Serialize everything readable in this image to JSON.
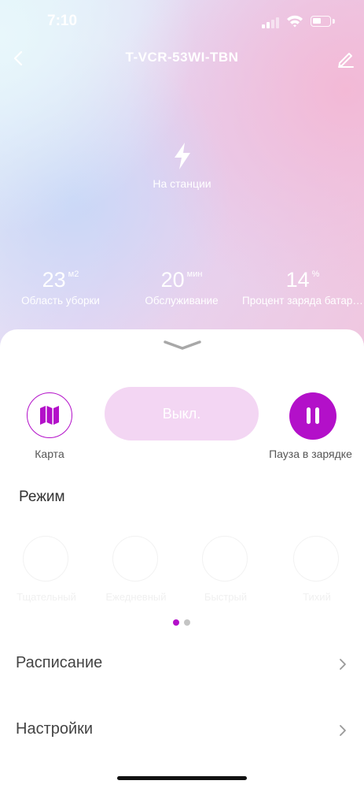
{
  "status_bar": {
    "time": "7:10",
    "battery_level": 0.55
  },
  "header": {
    "title": "T-VCR-53WI-TBN"
  },
  "device_status": {
    "text": "На станции"
  },
  "stats": [
    {
      "value": "23",
      "unit": "м2",
      "label": "Область уборки"
    },
    {
      "value": "20",
      "unit": "мин",
      "label": "Обслуживание"
    },
    {
      "value": "14",
      "unit": "%",
      "label": "Процент заряда батареи"
    }
  ],
  "controls": {
    "map_label": "Карта",
    "power_label": "Выкл.",
    "pause_label": "Пауза в зарядке"
  },
  "mode": {
    "title": "Режим",
    "items": [
      {
        "label": "Тщательный",
        "icon": "mode-thorough-icon"
      },
      {
        "label": "Ежедневный",
        "icon": "mode-daily-icon"
      },
      {
        "label": "Быстрый",
        "icon": "mode-quick-icon"
      },
      {
        "label": "Тихий",
        "icon": "mode-quiet-icon"
      }
    ],
    "pages": 2,
    "active_page": 0
  },
  "menu": {
    "schedule_label": "Расписание",
    "settings_label": "Настройки"
  },
  "colors": {
    "accent": "#b310c9",
    "accent_light": "#f3d6f3",
    "dot_inactive": "#c4c4c4"
  }
}
